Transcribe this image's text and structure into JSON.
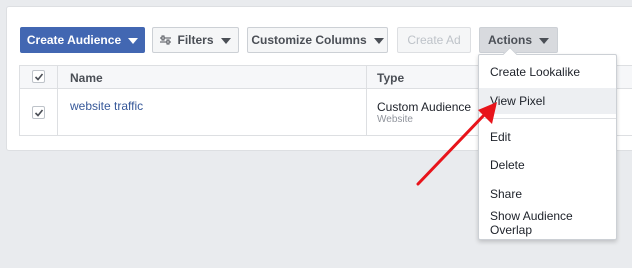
{
  "toolbar": {
    "create_audience": "Create Audience",
    "filters": "Filters",
    "customize_columns": "Customize Columns",
    "create_ad": "Create Ad",
    "actions": "Actions"
  },
  "table": {
    "columns": [
      "Name",
      "Type"
    ],
    "rows": [
      {
        "checked": true,
        "name": "website traffic",
        "type": "Custom Audience",
        "type_sub": "Website"
      }
    ]
  },
  "actions_menu": {
    "items": [
      "Create Lookalike",
      "View Pixel",
      "Edit",
      "Delete",
      "Share",
      "Show Audience Overlap"
    ],
    "highlighted": "View Pixel"
  },
  "annotation": {
    "arrow_color": "#e8141b"
  },
  "colors": {
    "primary": "#4267b2",
    "link": "#365899",
    "background": "#e9ebee"
  }
}
